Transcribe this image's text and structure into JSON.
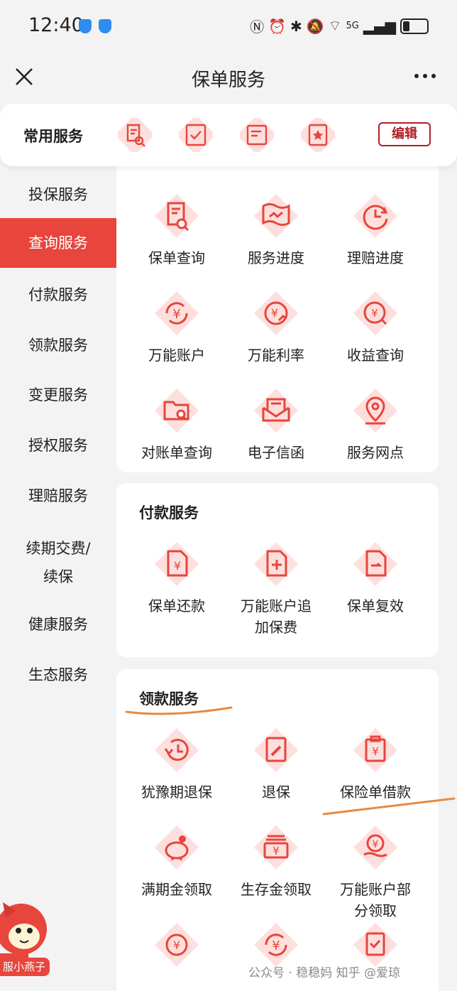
{
  "status_bar": {
    "time": "12:40",
    "network": "5G"
  },
  "nav": {
    "title": "保单服务"
  },
  "common": {
    "label": "常用服务",
    "icons": [
      "policy-search-icon",
      "check-doc-icon",
      "message-doc-icon",
      "star-doc-icon"
    ],
    "edit_label": "编辑"
  },
  "sidebar": {
    "items": [
      {
        "label": "投保服务"
      },
      {
        "label": "查询服务",
        "active": true
      },
      {
        "label": "付款服务"
      },
      {
        "label": "领款服务"
      },
      {
        "label": "变更服务"
      },
      {
        "label": "授权服务"
      },
      {
        "label": "理赔服务"
      },
      {
        "label": "续期交费/\n续保"
      },
      {
        "label": "健康服务"
      },
      {
        "label": "生态服务"
      }
    ]
  },
  "query_section": {
    "items": [
      {
        "label": "保单查询",
        "icon": "policy-search-icon"
      },
      {
        "label": "服务进度",
        "icon": "progress-icon"
      },
      {
        "label": "理赔进度",
        "icon": "clock-icon"
      },
      {
        "label": "万能账户",
        "icon": "yen-cycle-icon"
      },
      {
        "label": "万能利率",
        "icon": "yen-rate-icon"
      },
      {
        "label": "收益查询",
        "icon": "yen-search-icon"
      },
      {
        "label": "对账单查询",
        "icon": "folder-search-icon"
      },
      {
        "label": "电子信函",
        "icon": "envelope-icon"
      },
      {
        "label": "服务网点",
        "icon": "location-icon"
      }
    ]
  },
  "payment_section": {
    "title": "付款服务",
    "items": [
      {
        "label": "保单还款",
        "icon": "yen-doc-icon"
      },
      {
        "label": "万能账户追\n加保费",
        "icon": "plus-doc-icon"
      },
      {
        "label": "保单复效",
        "icon": "arrow-doc-icon"
      }
    ]
  },
  "collect_section": {
    "title": "领款服务",
    "items": [
      {
        "label": "犹豫期退保",
        "icon": "clock-return-icon"
      },
      {
        "label": "退保",
        "icon": "pen-doc-icon"
      },
      {
        "label": "保险单借款",
        "icon": "yen-clipboard-icon"
      },
      {
        "label": "满期金领取",
        "icon": "piggy-bank-icon"
      },
      {
        "label": "生存金领取",
        "icon": "yen-stack-icon"
      },
      {
        "label": "万能账户部\n分领取",
        "icon": "yen-hand-icon"
      },
      {
        "label": "",
        "icon": "yen-circle-icon"
      },
      {
        "label": "",
        "icon": "yen-cycle-icon"
      },
      {
        "label": "",
        "icon": "doc-check-icon"
      }
    ]
  },
  "mascot": {
    "label": "服小燕子"
  },
  "watermark": {
    "text": "公众号 · 稳稳妈 知乎 @爱琼"
  },
  "colors": {
    "accent": "#e8453c",
    "edit_border": "#b11f27",
    "diamond": "#fde0de",
    "underline": "#e58a43"
  }
}
